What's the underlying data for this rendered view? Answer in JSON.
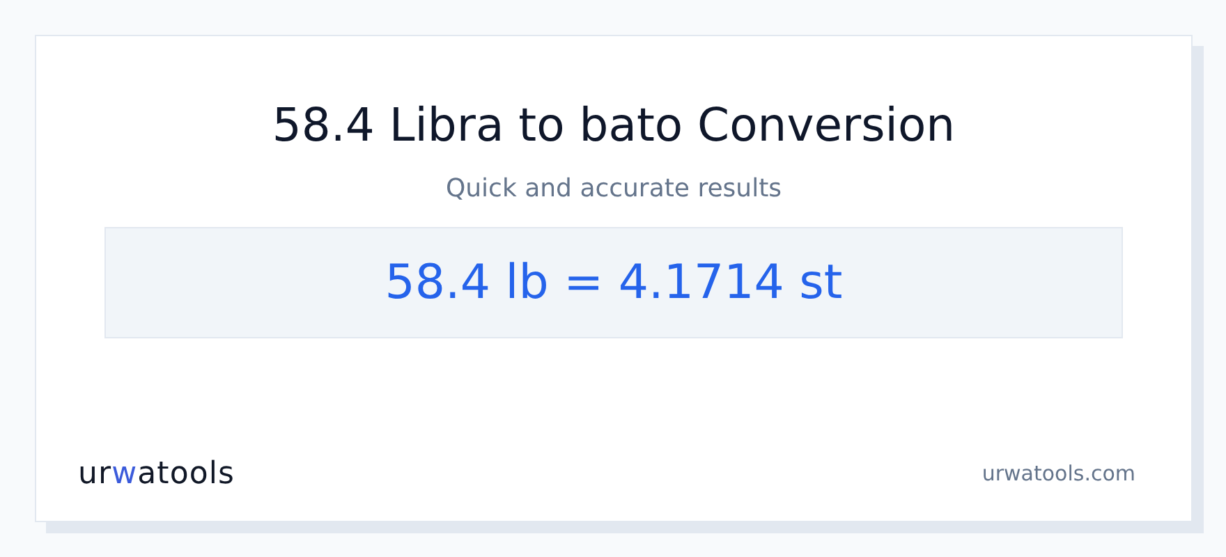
{
  "title": "58.4 Libra to bato Conversion",
  "subtitle": "Quick and accurate results",
  "result": "58.4 lb = 4.1714 st",
  "logo": {
    "text": "urwatools"
  },
  "site": "urwatools.com"
}
